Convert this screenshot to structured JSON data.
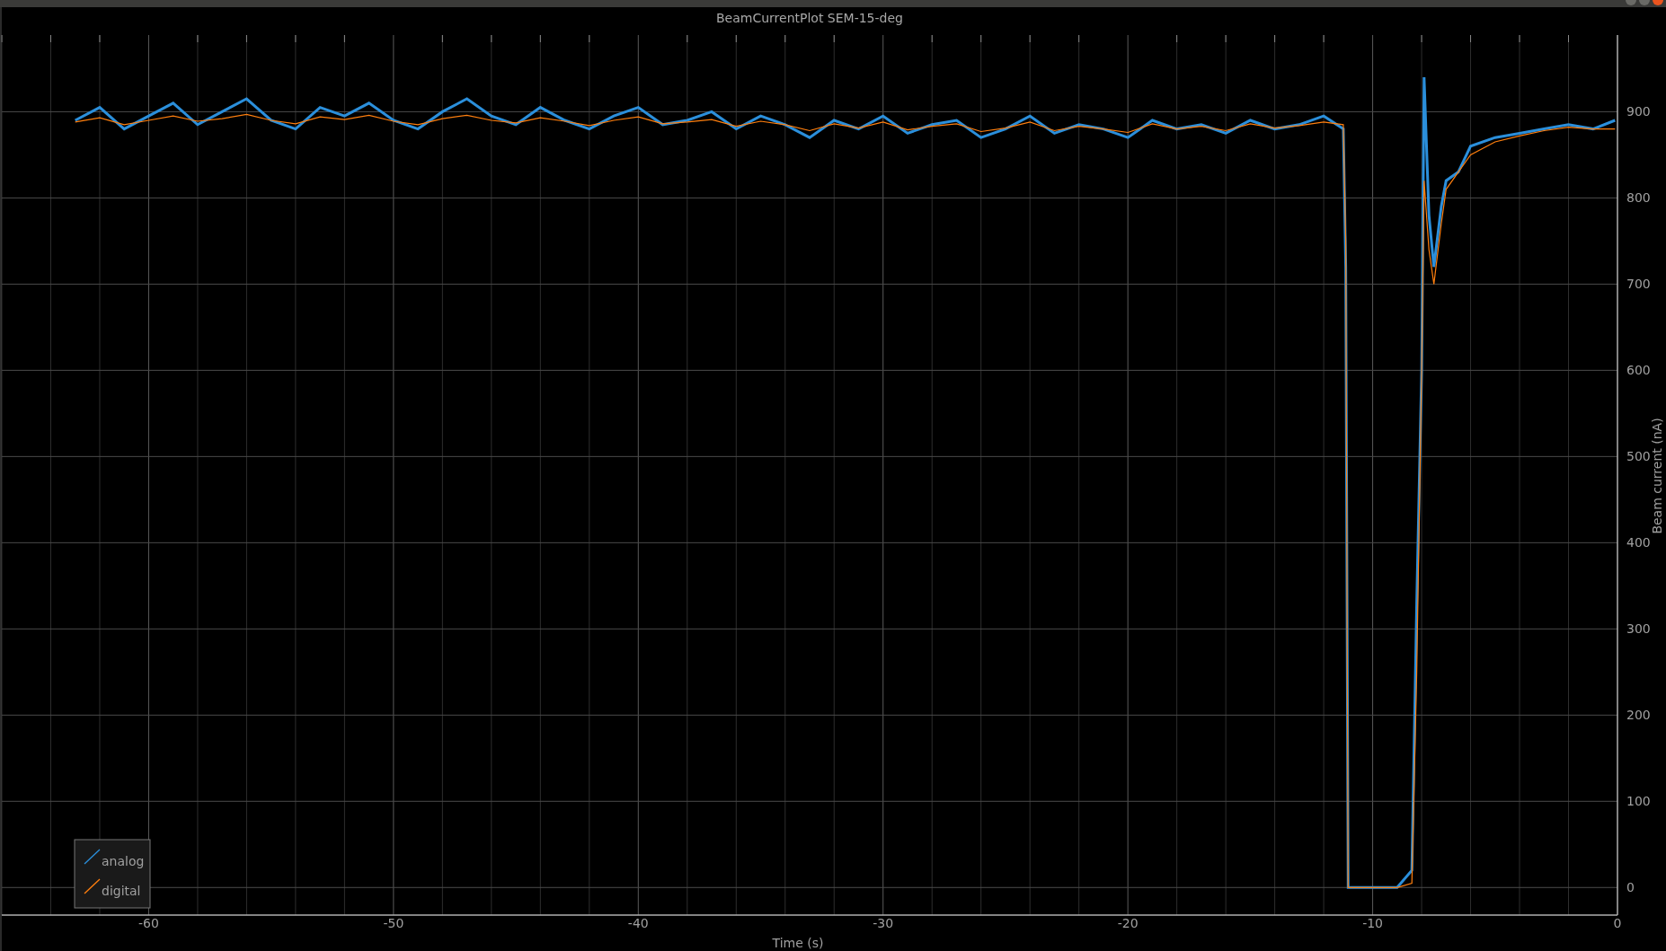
{
  "plot": {
    "chart_data": {
      "type": "line",
      "title": "BeamCurrentPlot SEM-15-deg",
      "xlabel": "Time (s)",
      "ylabel": "Beam current (nA)",
      "x": [
        -63,
        -62,
        -61,
        -60,
        -59,
        -58,
        -57,
        -56,
        -55,
        -54,
        -53,
        -52,
        -51,
        -50,
        -49,
        -48,
        -47,
        -46,
        -45,
        -44,
        -43,
        -42,
        -41,
        -40,
        -39,
        -38,
        -37,
        -36,
        -35,
        -34,
        -33,
        -32,
        -31,
        -30,
        -29,
        -28,
        -27,
        -26,
        -25,
        -24,
        -23,
        -22,
        -21,
        -20,
        -19,
        -18,
        -17,
        -16,
        -15,
        -14,
        -13,
        -12,
        -11.2,
        -11.1,
        -11,
        -10,
        -9,
        -8.4,
        -8.2,
        -8,
        -7.9,
        -7.7,
        -7.5,
        -7.2,
        -7,
        -6.5,
        -6,
        -5,
        -4,
        -3,
        -2,
        -1,
        -0.1
      ],
      "series": [
        {
          "name": "analog",
          "color": "#2b8fdb",
          "values": [
            890,
            905,
            880,
            895,
            910,
            885,
            900,
            915,
            890,
            880,
            905,
            895,
            910,
            890,
            880,
            900,
            915,
            895,
            885,
            905,
            890,
            880,
            895,
            905,
            885,
            890,
            900,
            880,
            895,
            885,
            870,
            890,
            880,
            895,
            875,
            885,
            890,
            870,
            880,
            895,
            875,
            885,
            880,
            870,
            890,
            880,
            885,
            875,
            890,
            880,
            885,
            895,
            880,
            720,
            0,
            0,
            0,
            20,
            330,
            600,
            940,
            780,
            720,
            790,
            820,
            830,
            860,
            870,
            875,
            880,
            885,
            880,
            890
          ]
        },
        {
          "name": "digital",
          "color": "#ff7f0e",
          "values": [
            888,
            893,
            885,
            890,
            895,
            889,
            892,
            897,
            890,
            886,
            894,
            891,
            896,
            889,
            885,
            892,
            896,
            890,
            887,
            893,
            889,
            884,
            890,
            894,
            886,
            888,
            891,
            883,
            889,
            885,
            878,
            886,
            881,
            888,
            879,
            883,
            886,
            877,
            881,
            888,
            878,
            883,
            880,
            876,
            886,
            880,
            883,
            878,
            886,
            881,
            884,
            888,
            885,
            750,
            0,
            0,
            0,
            5,
            250,
            600,
            820,
            740,
            700,
            770,
            810,
            830,
            850,
            865,
            872,
            878,
            882,
            880,
            880
          ]
        }
      ],
      "grid": true,
      "legend": "lower left",
      "xlim": [
        -66,
        0
      ],
      "ylim": [
        -32,
        989
      ],
      "xticks": [
        -60,
        -50,
        -40,
        -30,
        -20,
        -10,
        0
      ],
      "yticks": [
        0,
        100,
        200,
        300,
        400,
        500,
        600,
        700,
        800,
        900
      ]
    }
  }
}
